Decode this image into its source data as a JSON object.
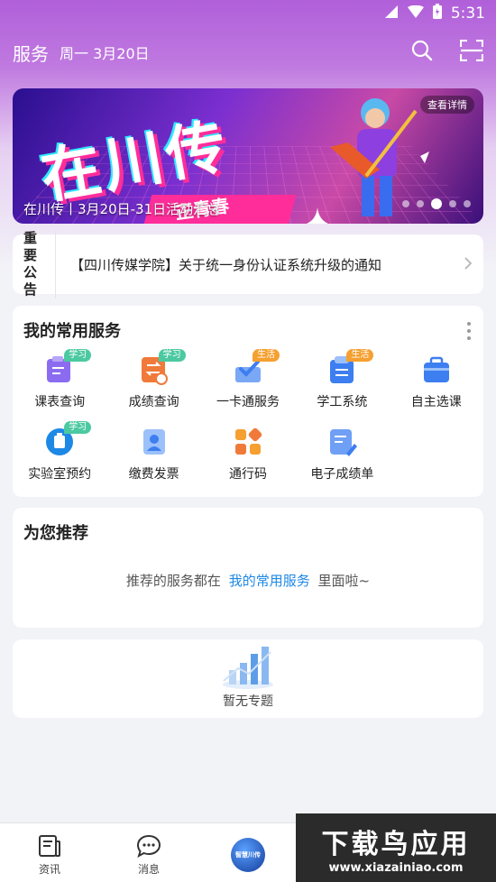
{
  "status_bar": {
    "time": "5:31"
  },
  "header": {
    "title": "服务",
    "date": "周一 3月20日"
  },
  "banner": {
    "big_text": "在川传",
    "slogan": "正青春",
    "detail_tag": "查看详情",
    "caption": "在川传丨3月20日-31日活动汇总",
    "dot_count": 5,
    "active_dot": 2
  },
  "notice": {
    "tag": "重要公告",
    "text": "【四川传媒学院】关于统一身份认证系统升级的通知"
  },
  "services": {
    "title": "我的常用服务",
    "items": [
      {
        "label": "课表查询",
        "badge": "学习",
        "badge_color": "#4cc9a0",
        "icon": "schedule-icon",
        "color": "#8b6cf0"
      },
      {
        "label": "成绩查询",
        "badge": "学习",
        "badge_color": "#4cc9a0",
        "icon": "grade-icon",
        "color": "#f07a3a"
      },
      {
        "label": "一卡通服务",
        "badge": "生活",
        "badge_color": "#f5a030",
        "icon": "card-icon",
        "color": "#3d7ef0"
      },
      {
        "label": "学工系统",
        "badge": "生活",
        "badge_color": "#f5a030",
        "icon": "student-affairs-icon",
        "color": "#3d7ef0"
      },
      {
        "label": "自主选课",
        "badge": "",
        "badge_color": "",
        "icon": "briefcase-icon",
        "color": "#3d7ef0"
      },
      {
        "label": "实验室预约",
        "badge": "学习",
        "badge_color": "#4cc9a0",
        "icon": "lab-icon",
        "color": "#1e88e5"
      },
      {
        "label": "缴费发票",
        "badge": "",
        "badge_color": "",
        "icon": "invoice-icon",
        "color": "#3d7ef0"
      },
      {
        "label": "通行码",
        "badge": "",
        "badge_color": "",
        "icon": "pass-code-icon",
        "color": "#f5a030"
      },
      {
        "label": "电子成绩单",
        "badge": "",
        "badge_color": "",
        "icon": "transcript-icon",
        "color": "#3d7ef0"
      }
    ]
  },
  "recommend": {
    "title": "为您推荐",
    "tip_before": "推荐的服务都在",
    "tip_link": "我的常用服务",
    "tip_after": "里面啦~"
  },
  "topics": {
    "empty_text": "暂无专题"
  },
  "tabbar": {
    "items": [
      {
        "label": "资讯",
        "icon": "news-icon"
      },
      {
        "label": "消息",
        "icon": "message-icon"
      },
      {
        "label": "",
        "icon": "smart-campus-logo"
      }
    ],
    "logo_text": "智慧川传"
  },
  "watermark": {
    "big": "下载鸟应用",
    "small": "www.xiazainiao.com"
  }
}
